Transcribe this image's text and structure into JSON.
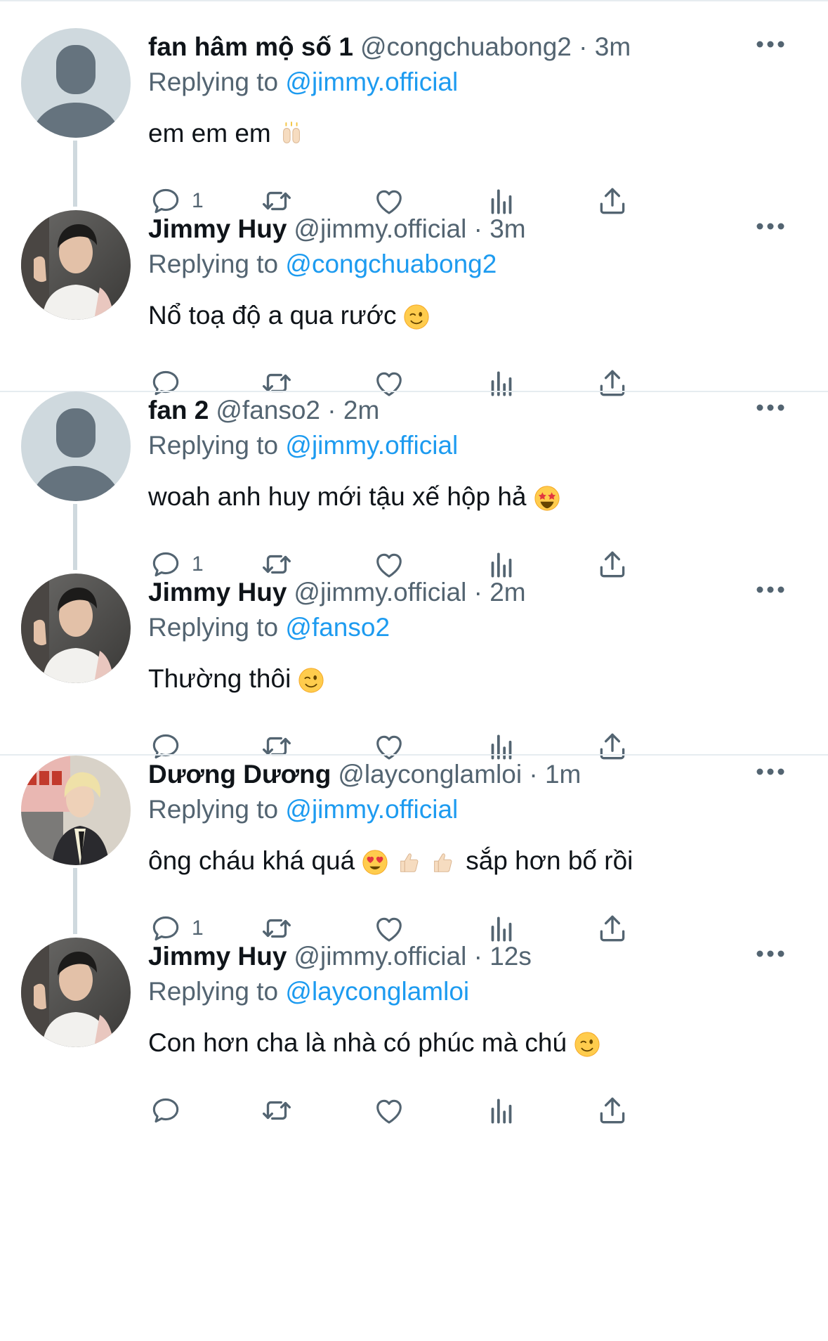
{
  "colors": {
    "text": "#0f1419",
    "secondary": "#536471",
    "link": "#1d9bf0",
    "divider": "#e6ecf0",
    "thread_line": "#cfd9de"
  },
  "threads": [
    {
      "tweets": [
        {
          "name": "fan hâm mộ số 1",
          "handle": "@congchuabong2",
          "time": "3m",
          "replying_prefix": "Replying to",
          "replying_to": "@jimmy.official",
          "text": "em em em",
          "emoji": [
            "raising-hands-emoji"
          ],
          "avatar": "default-avatar",
          "reply_count": "1"
        },
        {
          "name": "Jimmy Huy",
          "handle": "@jimmy.official",
          "time": "3m",
          "replying_prefix": "Replying to",
          "replying_to": "@congchuabong2",
          "text": "Nổ toạ độ a qua rước",
          "emoji": [
            "winking-face-emoji"
          ],
          "avatar": "jimmy-avatar",
          "reply_count": ""
        }
      ]
    },
    {
      "tweets": [
        {
          "name": "fan 2",
          "handle": "@fanso2",
          "time": "2m",
          "replying_prefix": "Replying to",
          "replying_to": "@jimmy.official",
          "text": "woah anh huy mới tậu xế hộp hả",
          "emoji": [
            "star-struck-emoji"
          ],
          "avatar": "default-avatar",
          "reply_count": "1"
        },
        {
          "name": "Jimmy Huy",
          "handle": "@jimmy.official",
          "time": "2m",
          "replying_prefix": "Replying to",
          "replying_to": "@fanso2",
          "text": "Thường thôi",
          "emoji": [
            "winking-face-emoji"
          ],
          "avatar": "jimmy-avatar",
          "reply_count": ""
        }
      ]
    },
    {
      "tweets": [
        {
          "name": "Dương Dương",
          "handle": "@layconglamloi",
          "time": "1m",
          "replying_prefix": "Replying to",
          "replying_to": "@jimmy.official",
          "text": "ông cháu khá quá",
          "emoji": [
            "heart-eyes-emoji",
            "thumbs-up-emoji",
            "thumbs-up-emoji"
          ],
          "text_after": "sắp hơn bố rồi",
          "avatar": "duong-avatar",
          "reply_count": "1"
        },
        {
          "name": "Jimmy Huy",
          "handle": "@jimmy.official",
          "time": "12s",
          "replying_prefix": "Replying to",
          "replying_to": "@layconglamloi",
          "text": "Con hơn cha là nhà có phúc mà chú",
          "emoji": [
            "winking-face-emoji"
          ],
          "avatar": "jimmy-avatar",
          "reply_count": ""
        }
      ]
    }
  ]
}
